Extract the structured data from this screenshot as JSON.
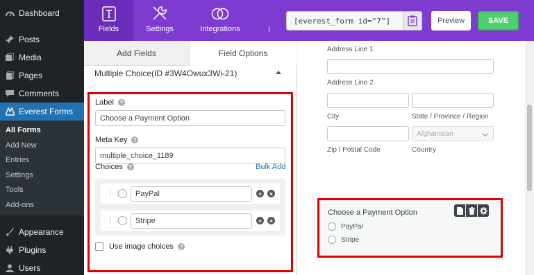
{
  "wp_menu": {
    "dashboard": "Dashboard",
    "posts": "Posts",
    "media": "Media",
    "pages": "Pages",
    "comments": "Comments",
    "everest_forms": "Everest Forms",
    "submenu": [
      "All Forms",
      "Add New",
      "Entries",
      "Settings",
      "Tools",
      "Add-ons"
    ],
    "appearance": "Appearance",
    "plugins": "Plugins",
    "users": "Users"
  },
  "header": {
    "tabs": [
      "Fields",
      "Settings",
      "Integrations"
    ],
    "shortcode": "[everest_form id=\"7\"]",
    "preview_label": "Preview",
    "save_label": "SAVE"
  },
  "panel": {
    "tab_add_fields": "Add Fields",
    "tab_field_options": "Field Options",
    "field_title": "Multiple Choice(ID #3W4Owux3Wi-21)",
    "label_label": "Label",
    "label_value": "Choose a Payment Option",
    "meta_key_label": "Meta Key",
    "meta_key_value": "multiple_choice_1189",
    "choices_label": "Choices",
    "bulk_add": "Bulk Add",
    "choices": [
      "PayPal",
      "Stripe"
    ],
    "image_choices_label": "Use image choices"
  },
  "canvas": {
    "address_line_1": "Address Line 1",
    "address_line_2": "Address Line 2",
    "city": "City",
    "state": "State / Province / Region",
    "country_value": "Afghanistan",
    "zip": "Zip / Postal Code",
    "country": "Country",
    "payment_title": "Choose a Payment Option",
    "payment_choices": [
      "PayPal",
      "Stripe"
    ]
  },
  "colors": {
    "header_purple": "#7e3bd0",
    "save_green": "#4cd070",
    "wp_active_blue": "#2271b1",
    "highlight_red": "#e00000"
  }
}
